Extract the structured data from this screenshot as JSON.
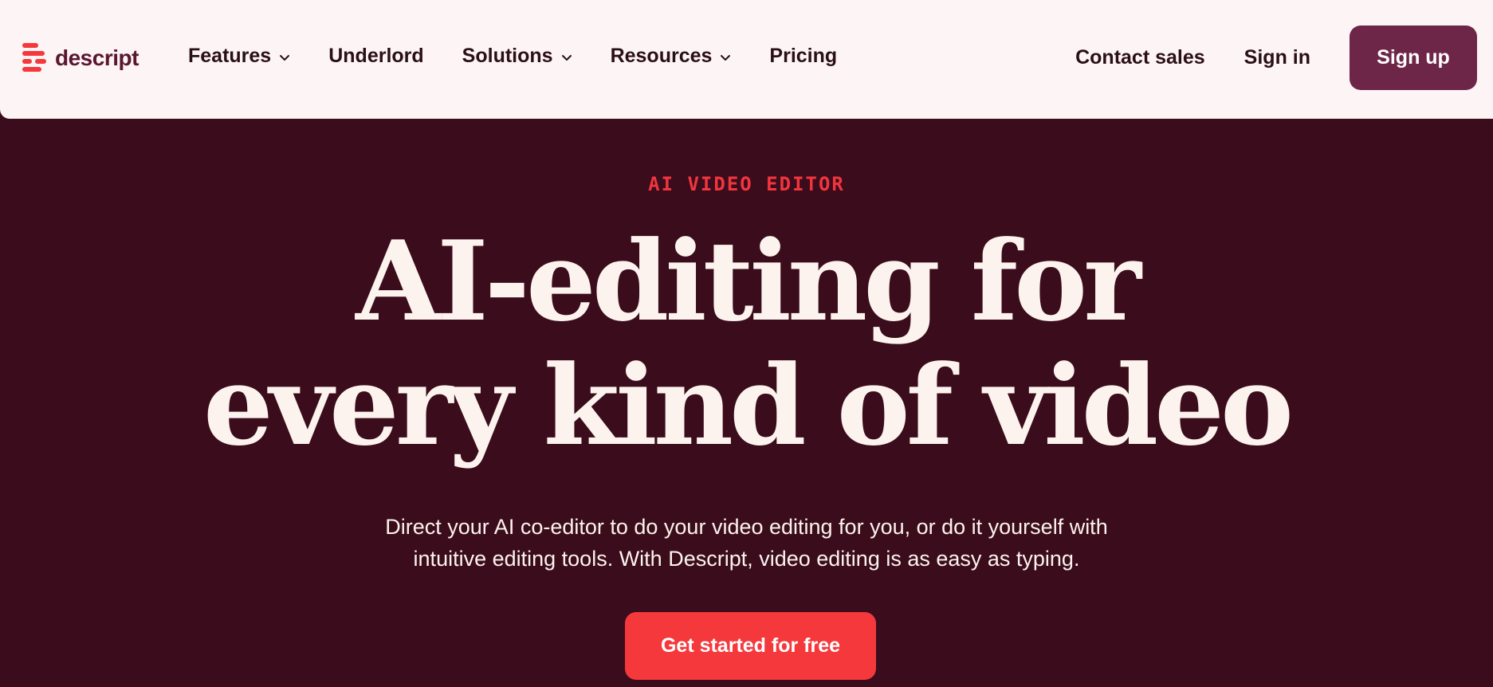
{
  "brand": {
    "name": "descript",
    "logo_icon": "descript-logo-icon",
    "colors": {
      "accent_red": "#f5383c",
      "plum": "#6e2648",
      "hero_bg": "#3a0c1c",
      "nav_bg": "#fdf4f5"
    }
  },
  "nav": {
    "items": [
      {
        "label": "Features",
        "has_dropdown": true
      },
      {
        "label": "Underlord",
        "has_dropdown": false
      },
      {
        "label": "Solutions",
        "has_dropdown": true
      },
      {
        "label": "Resources",
        "has_dropdown": true
      },
      {
        "label": "Pricing",
        "has_dropdown": false
      }
    ],
    "contact_sales": "Contact sales",
    "sign_in": "Sign in",
    "sign_up": "Sign up"
  },
  "hero": {
    "eyebrow": "AI VIDEO EDITOR",
    "headline_line1": "AI-editing for",
    "headline_line2": "every kind of video",
    "subcopy_line1": "Direct your AI co-editor to do your video editing for you, or do it yourself with",
    "subcopy_line2": "intuitive editing tools. With Descript, video editing is as easy as typing.",
    "cta": "Get started for free"
  }
}
